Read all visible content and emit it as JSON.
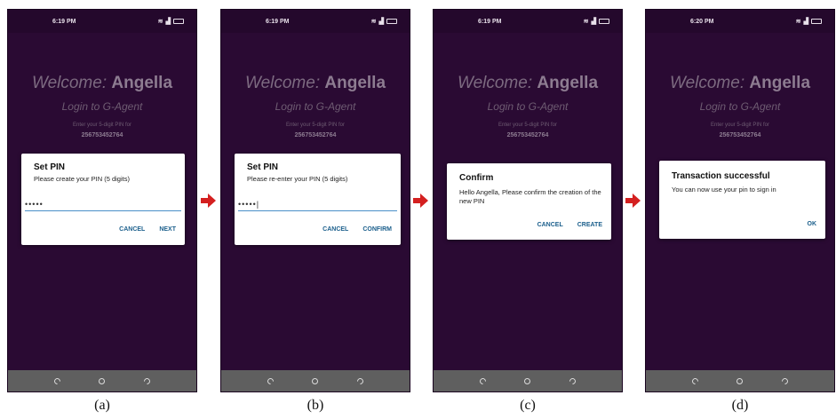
{
  "screens": [
    {
      "time": "6:19 PM",
      "welcome_prefix": "Welcome:",
      "welcome_name": "Angella",
      "login_text": "Login to G-Agent",
      "enter_text": "Enter your 5-digit PIN for",
      "phone": "256753452764",
      "dialog": {
        "title": "Set PIN",
        "message": "Please create your PIN (5 digits)",
        "pin": "•••••",
        "actions": [
          "CANCEL",
          "NEXT"
        ]
      },
      "caption": "(a)"
    },
    {
      "time": "6:19 PM",
      "welcome_prefix": "Welcome:",
      "welcome_name": "Angella",
      "login_text": "Login to G-Agent",
      "enter_text": "Enter your 5-digit PIN for",
      "phone": "256753452764",
      "dialog": {
        "title": "Set PIN",
        "message": "Please re-enter your PIN (5 digits)",
        "pin": "•••••|",
        "actions": [
          "CANCEL",
          "CONFIRM"
        ]
      },
      "caption": "(b)"
    },
    {
      "time": "6:19 PM",
      "welcome_prefix": "Welcome:",
      "welcome_name": "Angella",
      "login_text": "Login to G-Agent",
      "enter_text": "Enter your 5-digit PIN for",
      "phone": "256753452764",
      "dialog": {
        "title": "Confirm",
        "message": "Hello Angella, Please confirm the creation of the new PIN",
        "actions": [
          "CANCEL",
          "CREATE"
        ]
      },
      "caption": "(c)"
    },
    {
      "time": "6:20 PM",
      "welcome_prefix": "Welcome:",
      "welcome_name": "Angella",
      "login_text": "Login to G-Agent",
      "enter_text": "Enter your 5-digit PIN for",
      "phone": "256753452764",
      "dialog": {
        "title": "Transaction successful",
        "message": "You can now use your pin to sign in",
        "actions": [
          "OK"
        ]
      },
      "caption": "(d)"
    }
  ],
  "colors": {
    "screen_bg": "#2a0a33",
    "accent": "#1b5f8c",
    "arrow": "#d42020",
    "input_underline": "#4a90c8"
  }
}
